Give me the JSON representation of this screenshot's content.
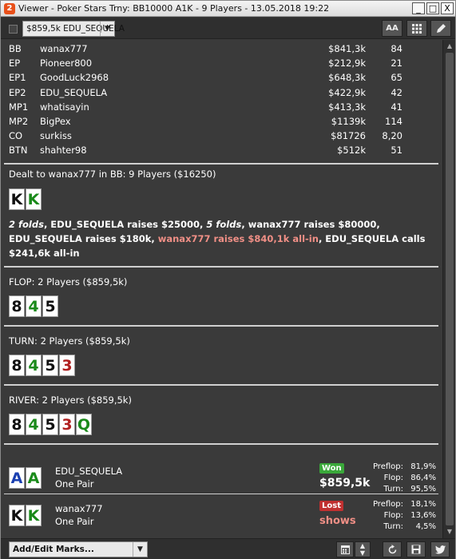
{
  "window": {
    "title": "Viewer - Poker Stars Trny: BB10000 A1K - 9 Players - 13.05.2018 19:22",
    "app_icon": "2",
    "min_label": "_",
    "max_label": "□",
    "close_label": "X"
  },
  "toolbar": {
    "hand_select_value": "$859,5k EDU_SEQUELA",
    "font_size_label": "AA",
    "grid_icon": "grid-icon",
    "edit_icon": "pencil-icon"
  },
  "players": [
    {
      "pos": "BB",
      "name": "wanax777",
      "stack": "$841,3k",
      "bb": "84"
    },
    {
      "pos": "EP",
      "name": "Pioneer800",
      "stack": "$212,9k",
      "bb": "21"
    },
    {
      "pos": "EP1",
      "name": "GoodLuck2968",
      "stack": "$648,3k",
      "bb": "65"
    },
    {
      "pos": "EP2",
      "name": "EDU_SEQUELA",
      "stack": "$422,9k",
      "bb": "42"
    },
    {
      "pos": "MP1",
      "name": "whatisayin",
      "stack": "$413,3k",
      "bb": "41"
    },
    {
      "pos": "MP2",
      "name": "BigPex",
      "stack": "$1139k",
      "bb": "114"
    },
    {
      "pos": "CO",
      "name": "surkiss",
      "stack": "$81726",
      "bb": "8,20"
    },
    {
      "pos": "BTN",
      "name": "shahter98",
      "stack": "$512k",
      "bb": "51"
    }
  ],
  "preflop": {
    "header": "Dealt to wanax777 in BB: 9 Players ($16250)",
    "hero_cards": [
      {
        "rank": "K",
        "suit": "black"
      },
      {
        "rank": "K",
        "suit": "green"
      }
    ],
    "action_1_folds": "2 folds",
    "action_2": ", EDU_SEQUELA raises $25000, ",
    "action_3_folds": "5 folds",
    "action_4": ", wanax777 raises $80000, EDU_SEQUELA raises $180k, ",
    "action_5_hero": "wanax777 raises $840,1k all-in",
    "action_6": ", EDU_SEQUELA calls $241,6k all-in"
  },
  "flop": {
    "header": "FLOP: 2 Players ($859,5k)",
    "cards": [
      {
        "rank": "8",
        "suit": "black"
      },
      {
        "rank": "4",
        "suit": "green"
      },
      {
        "rank": "5",
        "suit": "black"
      }
    ]
  },
  "turn": {
    "header": "TURN: 2 Players ($859,5k)",
    "cards": [
      {
        "rank": "8",
        "suit": "black"
      },
      {
        "rank": "4",
        "suit": "green"
      },
      {
        "rank": "5",
        "suit": "black"
      },
      {
        "rank": "3",
        "suit": "red"
      }
    ]
  },
  "river": {
    "header": "RIVER: 2 Players ($859,5k)",
    "cards": [
      {
        "rank": "8",
        "suit": "black"
      },
      {
        "rank": "4",
        "suit": "green"
      },
      {
        "rank": "5",
        "suit": "black"
      },
      {
        "rank": "3",
        "suit": "red"
      },
      {
        "rank": "Q",
        "suit": "green"
      }
    ]
  },
  "results": [
    {
      "name": "EDU_SEQUELA",
      "hand": "One Pair",
      "cards": [
        {
          "rank": "A",
          "suit": "blue"
        },
        {
          "rank": "A",
          "suit": "green"
        }
      ],
      "badge": "Won",
      "amount": "$859,5k",
      "preflop_label": "Preflop:",
      "preflop": "81,9%",
      "flop_label": "Flop:",
      "flop": "86,4%",
      "turn_label": "Turn:",
      "turn": "95,5%"
    },
    {
      "name": "wanax777",
      "hand": "One Pair",
      "cards": [
        {
          "rank": "K",
          "suit": "black"
        },
        {
          "rank": "K",
          "suit": "green"
        }
      ],
      "badge": "Lost",
      "amount": "shows",
      "preflop_label": "Preflop:",
      "preflop": "18,1%",
      "flop_label": "Flop:",
      "flop": "13,6%",
      "turn_label": "Turn:",
      "turn": "4,5%"
    }
  ],
  "bottom": {
    "marks_label": "Add/Edit Marks...",
    "calendar_icon": "calendar-icon",
    "refresh_icon": "refresh-icon",
    "save_icon": "save-icon",
    "twitter_icon": "twitter-icon"
  },
  "colors": {
    "background": "#3a3a3a",
    "hero_action": "#f08f86",
    "won": "#3aa83a",
    "lost": "#c03030",
    "suit_green": "#1a8a1a",
    "suit_red": "#b02020",
    "suit_blue": "#1a3fb0"
  }
}
